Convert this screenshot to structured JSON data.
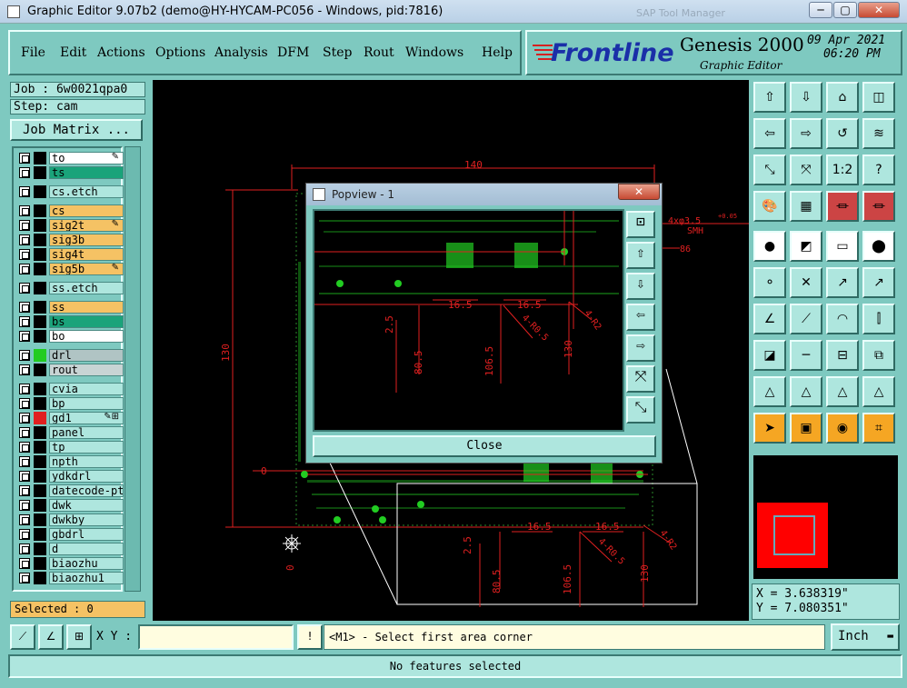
{
  "window": {
    "title": "Graphic Editor 9.07b2 (demo@HY-HYCAM-PC056 - Windows, pid:7816)",
    "background_window_title": "SAP Tool Manager",
    "minimize": "─",
    "maximize": "▢",
    "close": "✕"
  },
  "menu": {
    "file": "File",
    "edit": "Edit",
    "actions": "Actions",
    "options": "Options",
    "analysis": "Analysis",
    "dfm": "DFM",
    "step": "Step",
    "rout": "Rout",
    "windows": "Windows",
    "help": "Help"
  },
  "brand": {
    "logo": "Frontline",
    "product": "Genesis 2000",
    "subtitle": "Graphic Editor",
    "date": "09 Apr 2021",
    "time": "06:20 PM"
  },
  "job": {
    "job_label": "Job : 6w0021qpa0",
    "step_label": "Step: cam",
    "job_matrix": "Job Matrix ..."
  },
  "layers": [
    {
      "name": "to",
      "color": "#ffffff",
      "mark": "✎"
    },
    {
      "name": "ts",
      "color": "#1aa37a",
      "mark": ""
    },
    {
      "name": "cs.etch",
      "color": "#aee6de",
      "mark": ""
    },
    {
      "name": "cs",
      "color": "#f5c264",
      "mark": ""
    },
    {
      "name": "sig2t",
      "color": "#f5c264",
      "mark": "✎"
    },
    {
      "name": "sig3b",
      "color": "#f5c264",
      "mark": ""
    },
    {
      "name": "sig4t",
      "color": "#f5c264",
      "mark": ""
    },
    {
      "name": "sig5b",
      "color": "#f5c264",
      "mark": "✎"
    },
    {
      "name": "ss.etch",
      "color": "#aee6de",
      "mark": ""
    },
    {
      "name": "ss",
      "color": "#f5c264",
      "mark": ""
    },
    {
      "name": "bs",
      "color": "#1aa37a",
      "mark": ""
    },
    {
      "name": "bo",
      "color": "#ffffff",
      "mark": ""
    },
    {
      "name": "drl",
      "color": "#b0c4c4",
      "mark": ""
    },
    {
      "name": "rout",
      "color": "#c8d4d4",
      "mark": ""
    },
    {
      "name": "cvia",
      "color": "#aee6de",
      "mark": ""
    },
    {
      "name": "bp",
      "color": "#aee6de",
      "mark": ""
    },
    {
      "name": "gd1",
      "color": "#aee6de",
      "mark": "✎⊞"
    },
    {
      "name": "panel",
      "color": "#aee6de",
      "mark": ""
    },
    {
      "name": "tp",
      "color": "#aee6de",
      "mark": ""
    },
    {
      "name": "npth",
      "color": "#aee6de",
      "mark": ""
    },
    {
      "name": "ydkdrl",
      "color": "#aee6de",
      "mark": ""
    },
    {
      "name": "datecode-pto",
      "color": "#aee6de",
      "mark": ""
    },
    {
      "name": "dwk",
      "color": "#aee6de",
      "mark": ""
    },
    {
      "name": "dwkby",
      "color": "#aee6de",
      "mark": ""
    },
    {
      "name": "gbdrl",
      "color": "#aee6de",
      "mark": ""
    },
    {
      "name": "d",
      "color": "#aee6de",
      "mark": ""
    },
    {
      "name": "biaozhu",
      "color": "#aee6de",
      "mark": ""
    },
    {
      "name": "biaozhu1",
      "color": "#aee6de",
      "mark": ""
    }
  ],
  "selected": "Selected : 0",
  "canvas": {
    "dim_width": "140",
    "dim_height": "130",
    "dim_zero_h": "0",
    "dim_zero_v": "0",
    "dim_165a": "16.5",
    "dim_165b": "16.5",
    "dim_25": "2.5",
    "dim_805": "80.5",
    "dim_1065": "106.5",
    "dim_130": "130",
    "dim_4r05": "4-R0.5",
    "dim_4r2": "4-R2",
    "note1": "4xφ3.5",
    "note1_sup": "+0.05",
    "note2": "SMH",
    "note3": "86"
  },
  "popview": {
    "title": "Popview - 1",
    "close_x": "✕",
    "close_button": "Close"
  },
  "coords": {
    "x": "X = 3.638319\"",
    "y": "Y = 7.080351\""
  },
  "bottom": {
    "xy_label": "X Y :",
    "xy_value": "",
    "prompt": "<M1> - Select first area corner",
    "units": "Inch",
    "status": "No features selected",
    "warn": "!"
  }
}
